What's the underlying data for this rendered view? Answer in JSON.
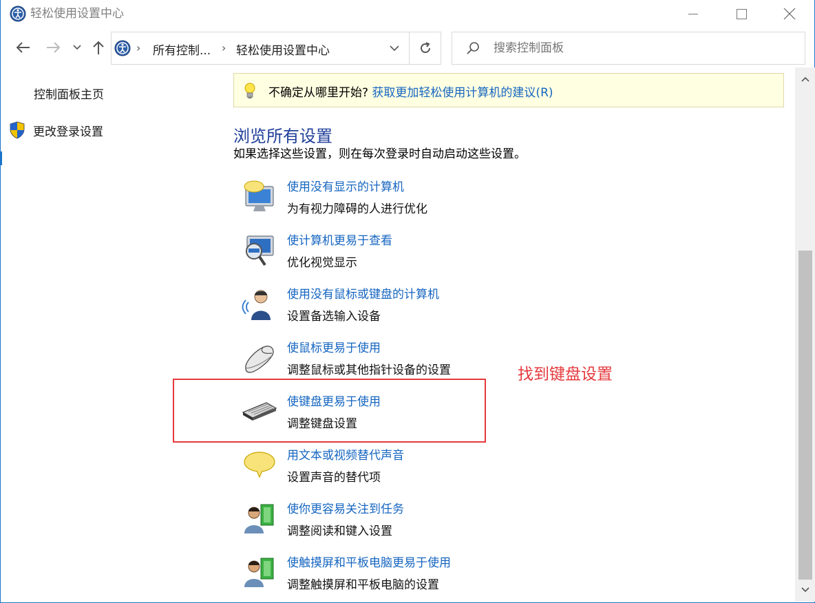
{
  "window": {
    "title": "轻松使用设置中心"
  },
  "address": {
    "crumbs": [
      "所有控制...",
      "轻松使用设置中心"
    ]
  },
  "search": {
    "placeholder": "搜索控制面板"
  },
  "sidebar": {
    "home": "控制面板主页",
    "login_settings": "更改登录设置"
  },
  "tip": {
    "prefix": "不确定从哪里开始? ",
    "link": "获取更加轻松使用计算机的建议(R)"
  },
  "main": {
    "heading": "浏览所有设置",
    "subheading": "如果选择这些设置，则在每次登录时自动启动这些设置。",
    "items": [
      {
        "link": "使用没有显示的计算机",
        "desc": "为有视力障碍的人进行优化",
        "icon": "monitor-speech-icon"
      },
      {
        "link": "使计算机更易于查看",
        "desc": "优化视觉显示",
        "icon": "magnifier-monitor-icon"
      },
      {
        "link": "使用没有鼠标或键盘的计算机",
        "desc": "设置备选输入设备",
        "icon": "headset-person-icon"
      },
      {
        "link": "使鼠标更易于使用",
        "desc": "调整鼠标或其他指针设备的设置",
        "icon": "mouse-icon"
      },
      {
        "link": "使键盘更易于使用",
        "desc": "调整键盘设置",
        "icon": "keyboard-icon"
      },
      {
        "link": "用文本或视频替代声音",
        "desc": "设置声音的替代项",
        "icon": "speech-bubble-icon"
      },
      {
        "link": "使你更容易关注到任务",
        "desc": "调整阅读和键入设置",
        "icon": "person-book-icon"
      },
      {
        "link": "使触摸屏和平板电脑更易于使用",
        "desc": "调整触摸屏和平板电脑的设置",
        "icon": "person-tablet-icon"
      }
    ]
  },
  "annotation": {
    "text": "找到键盘设置",
    "color": "#e5393d"
  },
  "colors": {
    "link": "#1565c0",
    "heading": "#1f3f99",
    "tip_bg": "#ffffe1"
  }
}
